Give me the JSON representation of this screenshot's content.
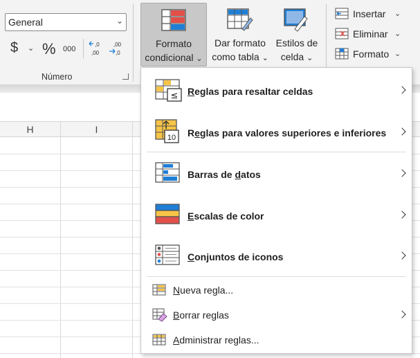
{
  "number_group": {
    "format_value": "General",
    "currency_symbol": "$",
    "percent_symbol": "%",
    "thousands_label": "000",
    "decimal_increase": "←,0 ,00",
    "decimal_decrease": ",00 →,0",
    "group_label": "Número"
  },
  "styles_group": {
    "conditional_format": {
      "line1": "Formato",
      "line2": "condicional"
    },
    "format_as_table": {
      "line1": "Dar formato",
      "line2": "como tabla"
    },
    "cell_styles": {
      "line1": "Estilos de",
      "line2": "celda"
    }
  },
  "cells_group": {
    "insert": "Insertar",
    "delete": "Eliminar",
    "format": "Formato"
  },
  "columns": [
    "H",
    "I"
  ],
  "menu": {
    "highlight_rules": {
      "first": "R",
      "rest": "eglas para resaltar celdas"
    },
    "top_bottom_rules": {
      "pre": "R",
      "u": "e",
      "rest": "glas para valores superiores e inferiores"
    },
    "data_bars": {
      "pre": "Barras de ",
      "u": "d",
      "rest": "atos"
    },
    "color_scales": {
      "first": "E",
      "rest": "scalas de color"
    },
    "icon_sets": {
      "first": "C",
      "rest": "onjuntos de iconos"
    },
    "new_rule": {
      "first": "N",
      "rest": "ueva regla..."
    },
    "clear_rules": {
      "first": "B",
      "rest": "orrar reglas"
    },
    "manage_rules": {
      "first": "A",
      "rest": "dministrar reglas..."
    },
    "icon_glyphs": {
      "less_equal": "≤",
      "ten": "10"
    }
  },
  "colors": {
    "accent_blue": "#1f7fd6",
    "icon_red": "#e3504a",
    "icon_yellow": "#f6c447",
    "active_button_bg": "#c8c8c8"
  }
}
